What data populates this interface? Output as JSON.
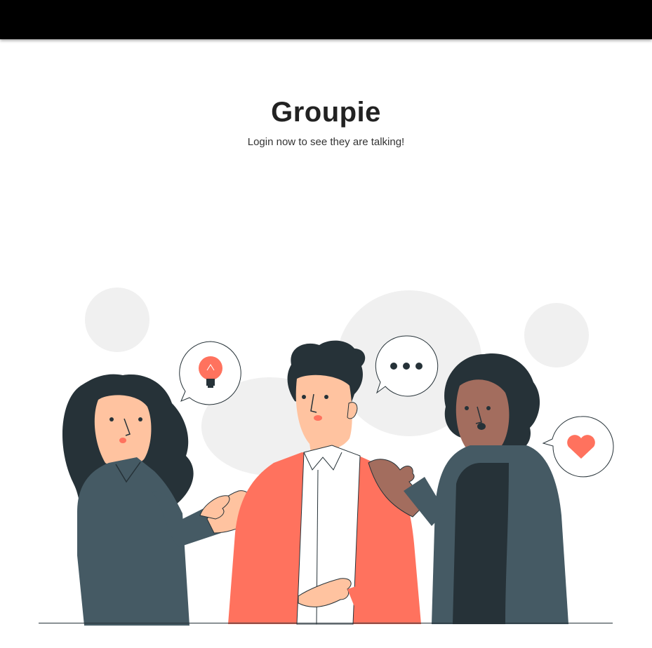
{
  "app": {
    "title": "Groupie",
    "tagline": "Login now to see they are talking!"
  },
  "colors": {
    "appbar": "#000000",
    "accent": "#ff725e",
    "dark": "#263238",
    "jacket_gray": "#455a64",
    "skin_light": "#ffc3a0",
    "skin_dark": "#a36d5e",
    "circle_bg": "#f0f0f0"
  },
  "illustration": {
    "description_icons": [
      "lightbulb-icon",
      "ellipsis-icon",
      "heart-icon"
    ]
  }
}
